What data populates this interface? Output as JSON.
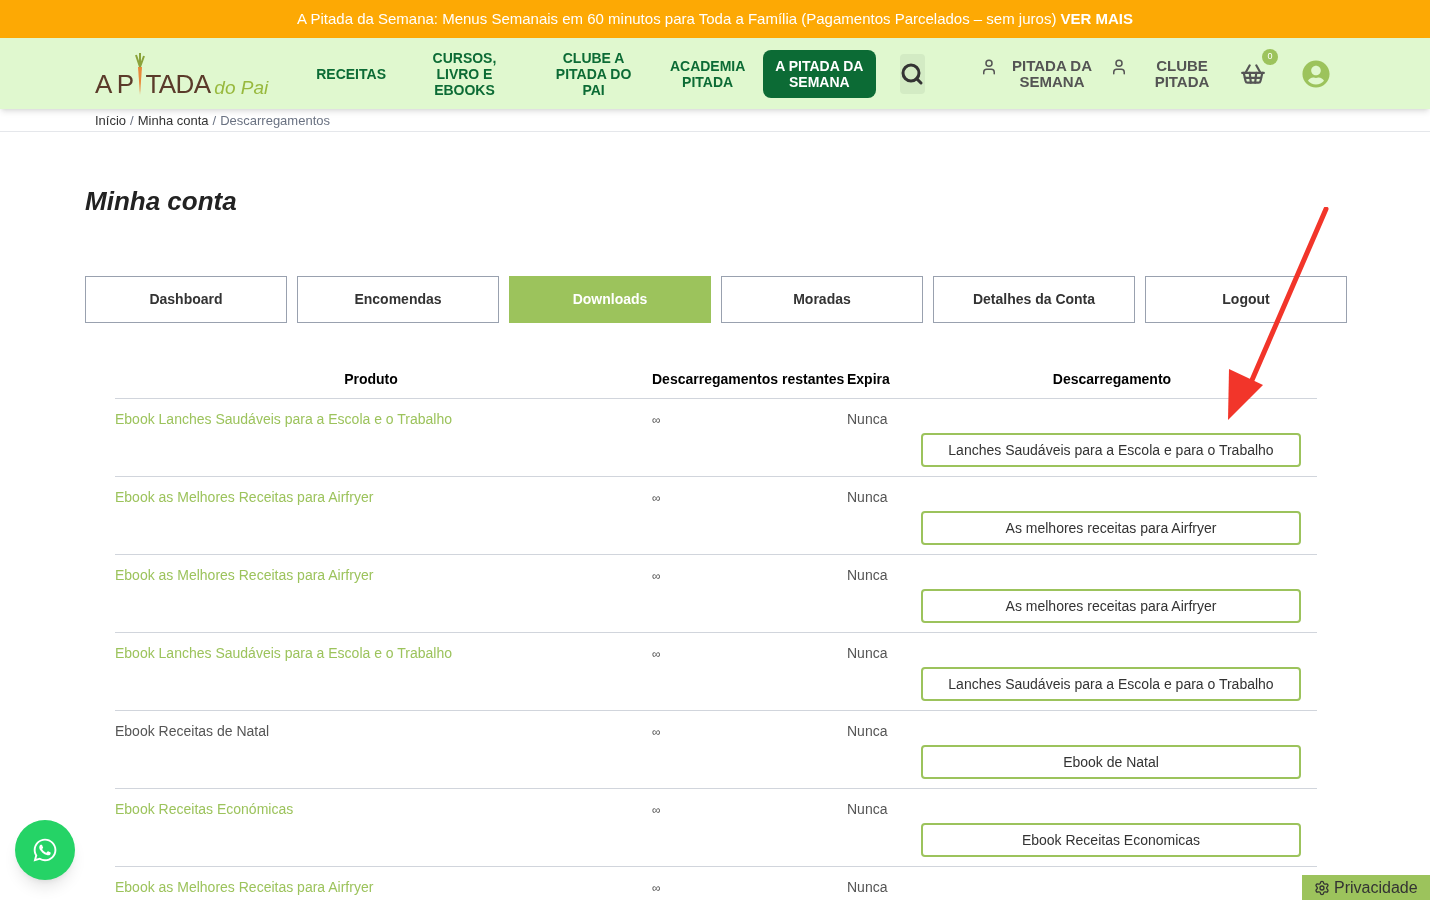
{
  "promo_bar": {
    "text": "A Pitada da Semana: Menus Semanais em 60 minutos para Toda a Família (Pagamentos Parcelados – sem juros)",
    "link": "VER MAIS"
  },
  "logo": {
    "left": "A P",
    "right": "TADA",
    "script": "do Pai"
  },
  "nav": [
    {
      "label": "RECEITAS",
      "kind": "link"
    },
    {
      "label": "CURSOS, LIVRO E EBOOKS",
      "kind": "link"
    },
    {
      "label": "CLUBE A PITADA DO PAI",
      "kind": "link"
    },
    {
      "label": "ACADEMIA PITADA",
      "kind": "link"
    },
    {
      "label": "A PITADA DA SEMANA",
      "kind": "highlight"
    }
  ],
  "account_links": [
    {
      "label": "PITADA DA SEMANA"
    },
    {
      "label": "CLUBE PITADA"
    }
  ],
  "cart": {
    "count": "0"
  },
  "breadcrumb": [
    {
      "kind": "link",
      "label": "Início"
    },
    {
      "kind": "separator",
      "label": "/"
    },
    {
      "kind": "link",
      "label": "Minha conta"
    },
    {
      "kind": "separator",
      "label": "/"
    },
    {
      "kind": "current",
      "label": "Descarregamentos"
    }
  ],
  "page_title": "Minha conta",
  "tabs": [
    {
      "label": "Dashboard",
      "selected": false
    },
    {
      "label": "Encomendas",
      "selected": false
    },
    {
      "label": "Downloads",
      "selected": true
    },
    {
      "label": "Moradas",
      "selected": false
    },
    {
      "label": "Detalhes da Conta",
      "selected": false
    },
    {
      "label": "Logout",
      "selected": false
    }
  ],
  "table": {
    "columns": [
      "Produto",
      "Descarregamentos restantes",
      "Expira",
      "Descarregamento"
    ],
    "rows": [
      {
        "product": "Ebook Lanches Saudáveis para a Escola e o Trabalho",
        "linked": true,
        "remaining": "∞",
        "expires": "Nunca",
        "download": "Lanches Saudáveis para a Escola e para o Trabalho"
      },
      {
        "product": "Ebook as Melhores Receitas para Airfryer",
        "linked": true,
        "remaining": "∞",
        "expires": "Nunca",
        "download": "As melhores receitas para Airfryer"
      },
      {
        "product": "Ebook as Melhores Receitas para Airfryer",
        "linked": true,
        "remaining": "∞",
        "expires": "Nunca",
        "download": "As melhores receitas para Airfryer"
      },
      {
        "product": "Ebook Lanches Saudáveis para a Escola e o Trabalho",
        "linked": true,
        "remaining": "∞",
        "expires": "Nunca",
        "download": "Lanches Saudáveis para a Escola e para o Trabalho"
      },
      {
        "product": "Ebook Receitas de Natal",
        "linked": false,
        "remaining": "∞",
        "expires": "Nunca",
        "download": "Ebook de Natal"
      },
      {
        "product": "Ebook Receitas Económicas",
        "linked": true,
        "remaining": "∞",
        "expires": "Nunca",
        "download": "Ebook Receitas Economicas"
      },
      {
        "product": "Ebook as Melhores Receitas para Airfryer",
        "linked": true,
        "remaining": "∞",
        "expires": "Nunca"
      }
    ]
  },
  "privacy_button": "Privacidade"
}
